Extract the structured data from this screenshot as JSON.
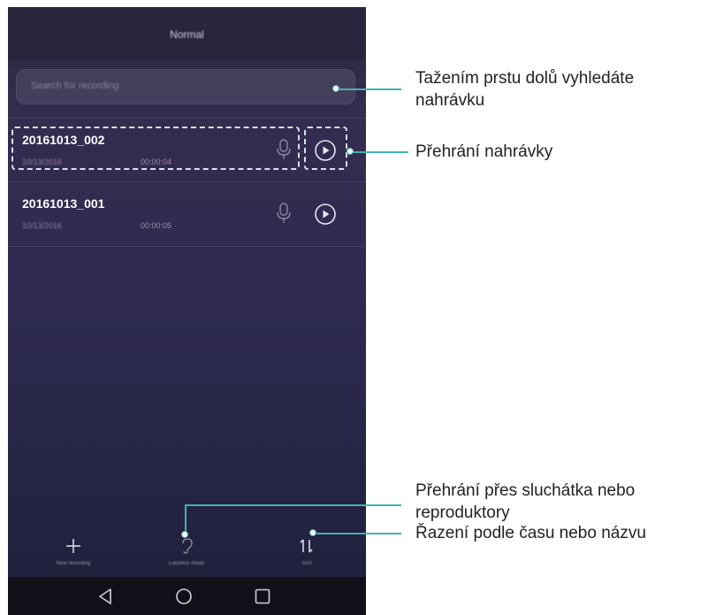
{
  "app": {
    "title": "Normal"
  },
  "search": {
    "placeholder": "Search for recording"
  },
  "recordings": [
    {
      "name": "20161013_002",
      "date": "10/13/2016",
      "duration": "00:00:04"
    },
    {
      "name": "20161013_001",
      "date": "10/13/2016",
      "duration": "00:00:05"
    }
  ],
  "toolbar": {
    "new_label": "New recording",
    "earpiece_label": "Earpiece mode",
    "sort_label": "Sort"
  },
  "annotations": {
    "search_line1": "Tažením prstu dolů vyhledáte",
    "search_line2": "nahrávku",
    "play": "Přehrání nahrávky",
    "earpiece_line1": "Přehrání přes sluchátka nebo",
    "earpiece_line2": "reproduktory",
    "sort": "Řazení podle času nebo názvu"
  },
  "colors": {
    "accent": "#43b3b3",
    "dashed": "#d8e4ee",
    "background": "#2f2a52"
  }
}
